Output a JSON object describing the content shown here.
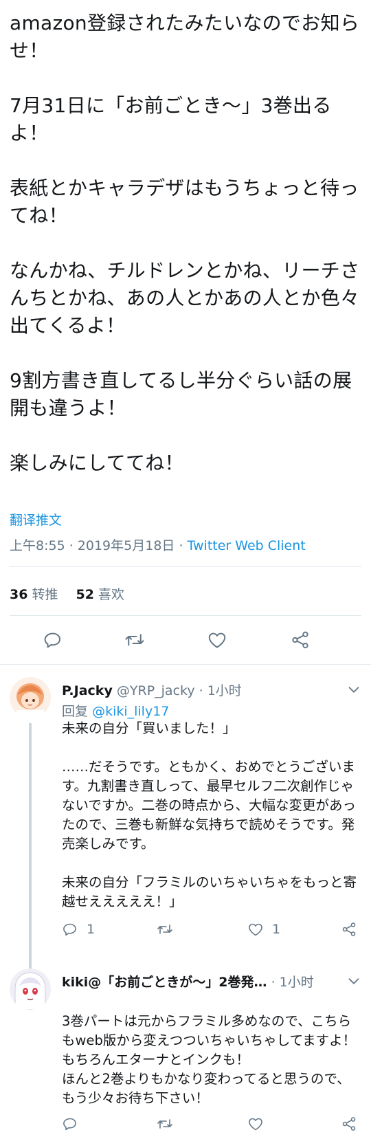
{
  "tweet": {
    "paragraphs": [
      "amazon登録されたみたいなのでお知らせ！",
      "7月31日に「お前ごとき〜」3巻出るよ！",
      "表紙とかキャラデザはもうちょっと待ってね！",
      "なんかね、チルドレンとかね、リーチさんちとかね、あの人とかあの人とか色々出てくるよ！",
      "9割方書き直してるし半分ぐらい話の展開も違うよ！",
      "楽しみにしててね！"
    ],
    "translate_label": "翻译推文",
    "time": "上午8:55",
    "date": "2019年5月18日",
    "separator": " · ",
    "client": "Twitter Web Client",
    "retweets_count": "36",
    "retweets_label": "转推",
    "likes_count": "52",
    "likes_label": "喜欢"
  },
  "replies": [
    {
      "name": "P.Jacky",
      "handle": "@YRP_jacky",
      "time": "· 1小时",
      "reply_to_label": "回复",
      "reply_to_handle": "@kiki_lily17",
      "paragraphs": [
        "未来の自分「買いました！」",
        "……だそうです。ともかく、おめでとうございます。九割書き直しって、最早セルフ二次創作じゃないですか。二巻の時点から、大幅な変更があったので、三巻も新鮮な気持ちで読めそうです。発売楽しみです。",
        "未来の自分「フラミルのいちゃいちゃをもっと寄越せえええええ！」"
      ],
      "reply_count": "1",
      "retweet_count": "",
      "like_count": "1"
    },
    {
      "name": "kiki@「お前ごときが〜」2巻発…",
      "handle": "",
      "time": "· 1小时",
      "paragraphs": [
        "3巻パートは元からフラミル多めなので、こちらもweb版から変えつついちゃいちゃしてますよ！\nもちろんエターナとインクも！\nほんと2巻よりもかなり変わってると思うので、もう少々お待ち下さい！"
      ],
      "reply_count": "",
      "retweet_count": "",
      "like_count": ""
    }
  ],
  "colors": {
    "link": "#1b95e0",
    "secondary": "#657786",
    "text": "#14171a",
    "divider": "#e1e8ed",
    "thread_line": "#ccd6dd"
  },
  "icons": [
    "reply-icon",
    "retweet-icon",
    "like-icon",
    "share-icon",
    "chevron-down-icon"
  ]
}
